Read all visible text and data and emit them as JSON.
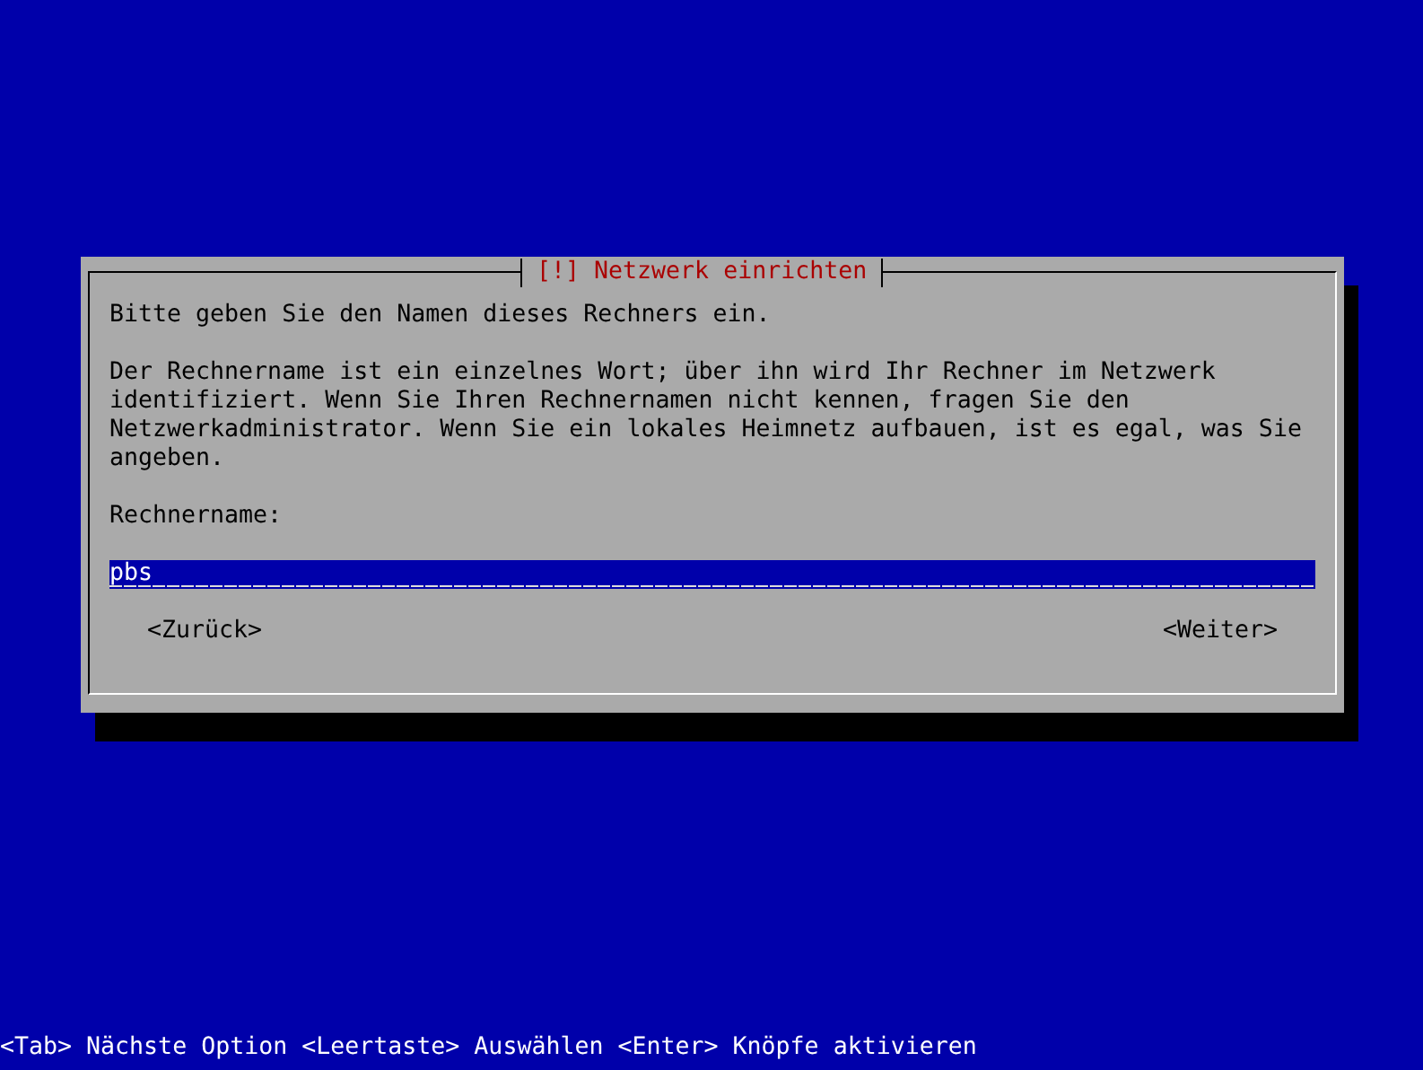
{
  "dialog": {
    "title": "[!] Netzwerk einrichten",
    "prompt": "Bitte geben Sie den Namen dieses Rechners ein.",
    "description": "Der Rechnername ist ein einzelnes Wort; über ihn wird Ihr Rechner im Netzwerk\nidentifiziert. Wenn Sie Ihren Rechnernamen nicht kennen, fragen Sie den\nNetzwerkadministrator. Wenn Sie ein lokales Heimnetz aufbauen, ist es egal, was Sie\nangeben.",
    "field": {
      "label": "Rechnername:",
      "value": "pbs"
    },
    "buttons": [
      {
        "label": "<Zurück>"
      },
      {
        "label": "<Weiter>"
      }
    ]
  },
  "status_bar": "<Tab> Nächste Option <Leertaste> Auswählen <Enter> Knöpfe aktivieren"
}
